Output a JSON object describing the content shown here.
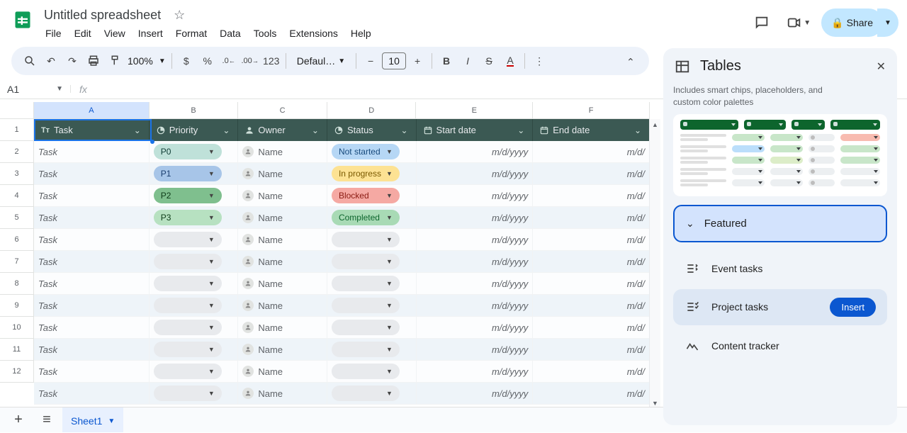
{
  "header": {
    "title": "Untitled spreadsheet",
    "menus": [
      "File",
      "Edit",
      "View",
      "Insert",
      "Format",
      "Data",
      "Tools",
      "Extensions",
      "Help"
    ],
    "share": "Share"
  },
  "toolbar": {
    "zoom": "100%",
    "font": "Defaul…",
    "font_size": "10",
    "num_label": "123"
  },
  "fxrow": {
    "cell": "A1",
    "fx": "fx"
  },
  "columns": [
    "A",
    "B",
    "C",
    "D",
    "E",
    "F"
  ],
  "tablehead": {
    "task": "Task",
    "priority": "Priority",
    "owner": "Owner",
    "status": "Status",
    "start": "Start date",
    "end": "End date"
  },
  "rows": [
    {
      "task": "Task",
      "priority": {
        "text": "P0",
        "bg": "#bfe1d9",
        "fg": "#0d3b33"
      },
      "owner": "Name",
      "status": {
        "text": "Not started",
        "bg": "#b6d7f5",
        "fg": "#174a7c"
      },
      "start": "m/d/yyyy",
      "end": "m/d/"
    },
    {
      "task": "Task",
      "priority": {
        "text": "P1",
        "bg": "#a7c5e8",
        "fg": "#1a3e6e"
      },
      "owner": "Name",
      "status": {
        "text": "In progress",
        "bg": "#fde293",
        "fg": "#7a5900"
      },
      "start": "m/d/yyyy",
      "end": "m/d/"
    },
    {
      "task": "Task",
      "priority": {
        "text": "P2",
        "bg": "#7fbf8e",
        "fg": "#0d3b18"
      },
      "owner": "Name",
      "status": {
        "text": "Blocked",
        "bg": "#f5a9a3",
        "fg": "#8a1b12"
      },
      "start": "m/d/yyyy",
      "end": "m/d/"
    },
    {
      "task": "Task",
      "priority": {
        "text": "P3",
        "bg": "#b7e1c1",
        "fg": "#0d3b18"
      },
      "owner": "Name",
      "status": {
        "text": "Completed",
        "bg": "#a8dab5",
        "fg": "#0d652d"
      },
      "start": "m/d/yyyy",
      "end": "m/d/"
    },
    {
      "task": "Task",
      "priority": null,
      "owner": "Name",
      "status": null,
      "start": "m/d/yyyy",
      "end": "m/d/"
    },
    {
      "task": "Task",
      "priority": null,
      "owner": "Name",
      "status": null,
      "start": "m/d/yyyy",
      "end": "m/d/"
    },
    {
      "task": "Task",
      "priority": null,
      "owner": "Name",
      "status": null,
      "start": "m/d/yyyy",
      "end": "m/d/"
    },
    {
      "task": "Task",
      "priority": null,
      "owner": "Name",
      "status": null,
      "start": "m/d/yyyy",
      "end": "m/d/"
    },
    {
      "task": "Task",
      "priority": null,
      "owner": "Name",
      "status": null,
      "start": "m/d/yyyy",
      "end": "m/d/"
    },
    {
      "task": "Task",
      "priority": null,
      "owner": "Name",
      "status": null,
      "start": "m/d/yyyy",
      "end": "m/d/"
    },
    {
      "task": "Task",
      "priority": null,
      "owner": "Name",
      "status": null,
      "start": "m/d/yyyy",
      "end": "m/d/"
    },
    {
      "task": "Task",
      "priority": null,
      "owner": "Name",
      "status": null,
      "start": "m/d/yyyy",
      "end": "m/d/"
    }
  ],
  "sheettab": "Sheet1",
  "side": {
    "title": "Tables",
    "desc": "custom color palettes",
    "desc_top": "Includes smart chips, placeholders, and",
    "featured": "Featured",
    "templates": [
      {
        "label": "Event tasks",
        "active": false
      },
      {
        "label": "Project tasks",
        "active": true
      },
      {
        "label": "Content tracker",
        "active": false
      }
    ],
    "insert": "Insert"
  },
  "preview_colors": {
    "r1": [
      "#c8e6c9",
      "#c8e6c9",
      "#e0e0e0",
      "#f8bbb0"
    ],
    "r2": [
      "#bbdefb",
      "#c8e6c9",
      "#e0e0e0",
      "#c8e6c9"
    ],
    "r3": [
      "#c8e6c9",
      "#dcedc8",
      "#e0e0e0",
      "#c8e6c9"
    ],
    "r4": [
      "#eceff1",
      "#eceff1",
      "#e0e0e0",
      "#eceff1"
    ],
    "r5": [
      "#eceff1",
      "#eceff1",
      "#e0e0e0",
      "#eceff1"
    ]
  }
}
